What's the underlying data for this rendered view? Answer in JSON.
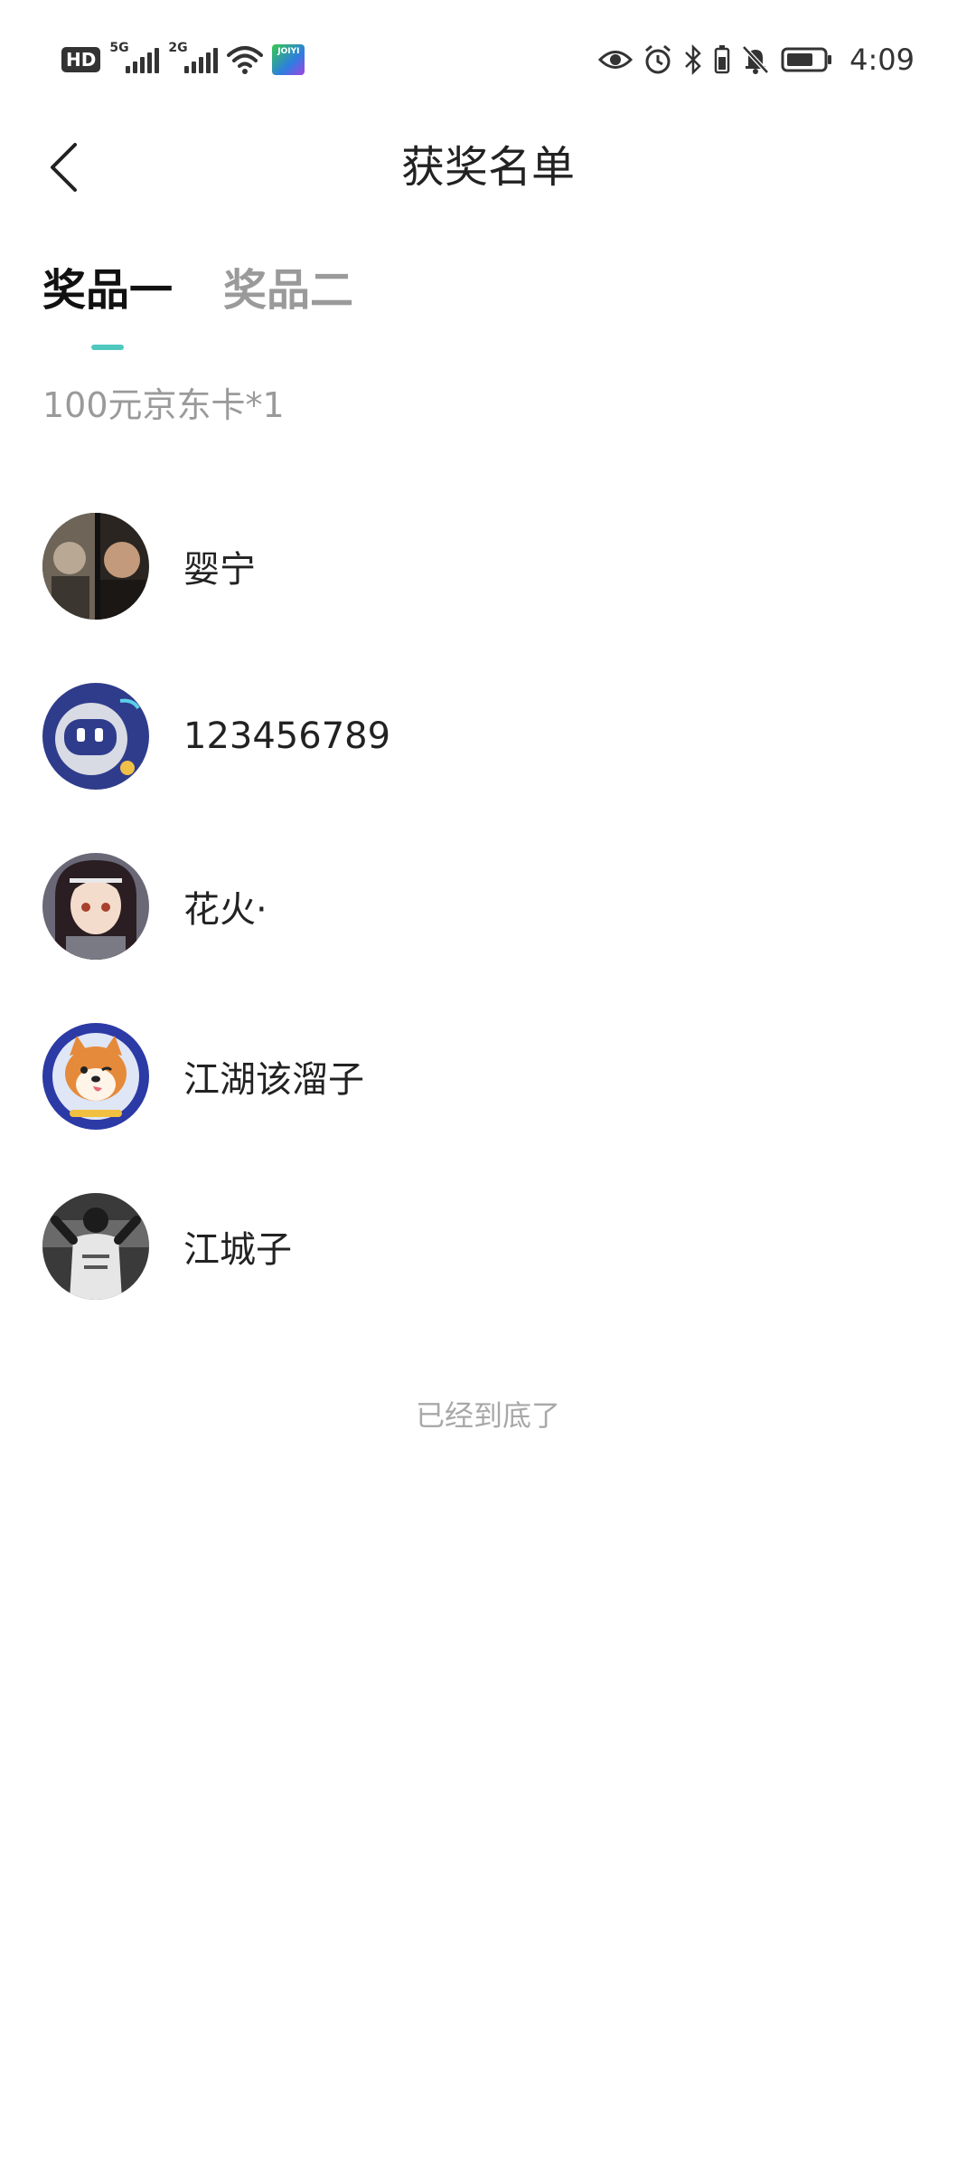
{
  "status_bar": {
    "hd": "HD",
    "sim1": "5G",
    "sim2": "2G",
    "app_badge": "JOIYI",
    "time": "4:09"
  },
  "header": {
    "title": "获奖名单",
    "back_icon": "chevron-left-icon"
  },
  "tabs": [
    {
      "label": "奖品一",
      "active": true
    },
    {
      "label": "奖品二",
      "active": false
    }
  ],
  "prize": {
    "label": "100元京东卡*1"
  },
  "winners": [
    {
      "name": "婴宁",
      "avatar": "movie-still-avatar"
    },
    {
      "name": "123456789",
      "avatar": "robot-avatar"
    },
    {
      "name": "花火·",
      "avatar": "anime-girl-avatar"
    },
    {
      "name": "江湖该溜子",
      "avatar": "shiba-dog-avatar"
    },
    {
      "name": "江城子",
      "avatar": "bw-person-avatar"
    }
  ],
  "footer": {
    "end_text": "已经到底了"
  },
  "colors": {
    "accent": "#4fc8c0",
    "muted_text": "#9a9a9a",
    "primary_text": "#222222"
  }
}
